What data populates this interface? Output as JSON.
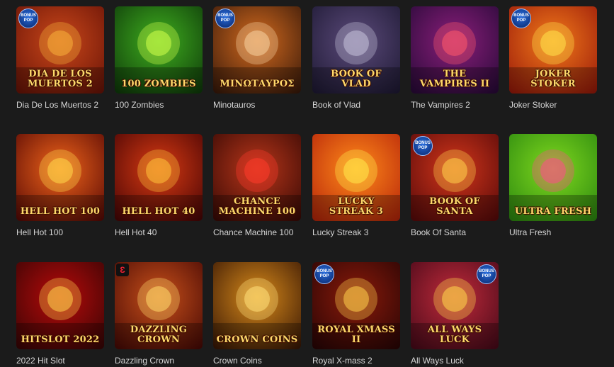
{
  "badge_text": [
    "BONUS",
    "POP"
  ],
  "provider_mark": "Ɛ",
  "games": [
    {
      "title": "Dia De Los Muertos 2",
      "logo": "DIA DE LOS MUERTOS 2",
      "bg": [
        "#6b1407",
        "#c9471a"
      ],
      "accent": "#f7b13a",
      "badge": "left"
    },
    {
      "title": "100 Zombies",
      "logo": "100 ZOMBIES",
      "bg": [
        "#0f3c0a",
        "#3fae1f"
      ],
      "accent": "#d2ff4a",
      "badge": "none"
    },
    {
      "title": "Minotauros",
      "logo": "ΜΙΝΩΤΑΥΡΟΣ",
      "bg": [
        "#3a1a0a",
        "#d36a1e"
      ],
      "accent": "#f5d2a0",
      "badge": "left"
    },
    {
      "title": "Book of Vlad",
      "logo": "Book of Vlad",
      "bg": [
        "#1f1a35",
        "#5b4a7a"
      ],
      "accent": "#c7c3da",
      "badge": "none"
    },
    {
      "title": "The Vampires 2",
      "logo": "the Vampires II",
      "bg": [
        "#2a0a3a",
        "#8a1e7a"
      ],
      "accent": "#ff5a6a",
      "badge": "none"
    },
    {
      "title": "Joker Stoker",
      "logo": "JOKER STOKER",
      "bg": [
        "#9a1a0a",
        "#f27a1a"
      ],
      "accent": "#ffe14a",
      "badge": "left"
    },
    {
      "title": "Hell Hot 100",
      "logo": "HELL HOT 100",
      "bg": [
        "#5a0a05",
        "#f0641a"
      ],
      "accent": "#ffd84a",
      "badge": "none"
    },
    {
      "title": "Hell Hot 40",
      "logo": "HELL HOT 40",
      "bg": [
        "#4a0505",
        "#d83a12"
      ],
      "accent": "#ffc23a",
      "badge": "none"
    },
    {
      "title": "Chance Machine 100",
      "logo": "CHANCE machine 100",
      "bg": [
        "#3a0a05",
        "#b8361a"
      ],
      "accent": "#ff3a2a",
      "badge": "none"
    },
    {
      "title": "Lucky Streak 3",
      "logo": "Lucky STREAK 3",
      "bg": [
        "#b8260a",
        "#ff8a1a"
      ],
      "accent": "#ffea4a",
      "badge": "none"
    },
    {
      "title": "Book Of Santa",
      "logo": "Book of Santa",
      "bg": [
        "#5a0a0a",
        "#d2361a"
      ],
      "accent": "#ffd24a",
      "badge": "left"
    },
    {
      "title": "Ultra Fresh",
      "logo": "Ultra Fresh",
      "bg": [
        "#2e8a10",
        "#7fd81e"
      ],
      "accent": "#ff4a8a",
      "badge": "none"
    },
    {
      "title": "2022 Hit Slot",
      "logo": "HITSLOT 2022",
      "bg": [
        "#3a0505",
        "#b80a0a"
      ],
      "accent": "#ffd24a",
      "badge": "none"
    },
    {
      "title": "Dazzling Crown",
      "logo": "Dazzling Crown",
      "bg": [
        "#4a0a05",
        "#c8501a"
      ],
      "accent": "#ffd86a",
      "badge": "provider"
    },
    {
      "title": "Crown Coins",
      "logo": "CROWN COINS",
      "bg": [
        "#3a1805",
        "#d88a1a"
      ],
      "accent": "#ffe07a",
      "badge": "none"
    },
    {
      "title": "Royal X-mass 2",
      "logo": "ROYAL XMASS II",
      "bg": [
        "#2a0505",
        "#8a1a0a"
      ],
      "accent": "#ffcf4a",
      "badge": "left"
    },
    {
      "title": "All Ways Luck",
      "logo": "All Ways LUCK",
      "bg": [
        "#4a0a1a",
        "#c02a3a"
      ],
      "accent": "#ffd84a",
      "badge": "right"
    }
  ]
}
